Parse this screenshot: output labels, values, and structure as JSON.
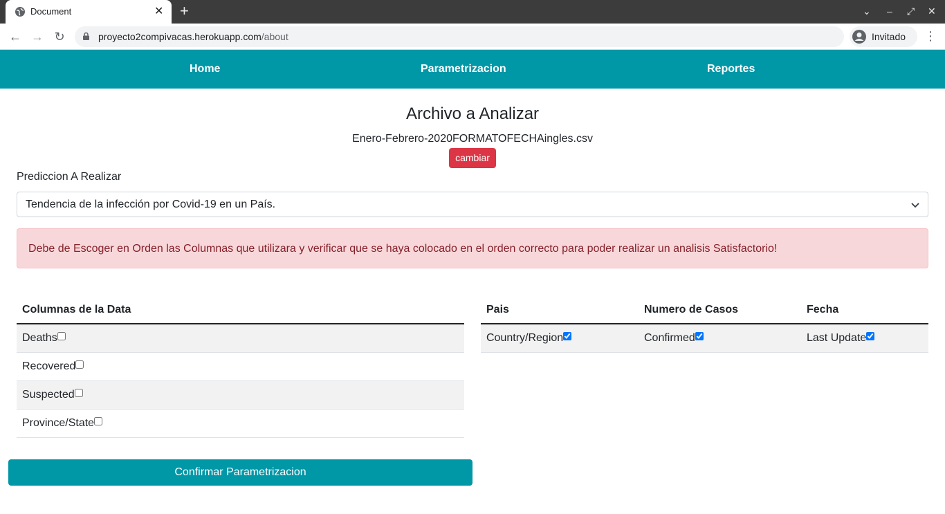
{
  "browser": {
    "tab_title": "Document",
    "url_host": "proyecto2compivacas.herokuapp.com",
    "url_path": "/about",
    "profile_label": "Invitado"
  },
  "nav": {
    "home": "Home",
    "parametrizacion": "Parametrizacion",
    "reportes": "Reportes"
  },
  "main": {
    "title": "Archivo a Analizar",
    "filename": "Enero-Febrero-2020FORMATOFECHAingles.csv",
    "change_button": "cambiar",
    "prediction_label": "Prediccion A Realizar",
    "prediction_selected": "Tendencia de la infección por Covid-19 en un País.",
    "alert": "Debe de Escoger en Orden las Columnas que utilizara y verificar que se haya colocado en el orden correcto para poder realizar un analisis Satisfactorio!",
    "confirm_button": "Confirmar Parametrizacion"
  },
  "data_columns": {
    "header": "Columnas de la Data",
    "items": [
      {
        "label": "Deaths",
        "checked": false
      },
      {
        "label": "Recovered",
        "checked": false
      },
      {
        "label": "Suspected",
        "checked": false
      },
      {
        "label": "Province/State",
        "checked": false
      }
    ]
  },
  "selected_columns": {
    "headers": [
      "Pais",
      "Numero de Casos",
      "Fecha"
    ],
    "values": [
      {
        "label": "Country/Region",
        "checked": true
      },
      {
        "label": "Confirmed",
        "checked": true
      },
      {
        "label": "Last Update",
        "checked": true
      }
    ]
  },
  "colors": {
    "nav_bg": "#0097a7",
    "danger": "#dc3545",
    "alert_bg": "#f8d7da",
    "alert_text": "#842029"
  }
}
